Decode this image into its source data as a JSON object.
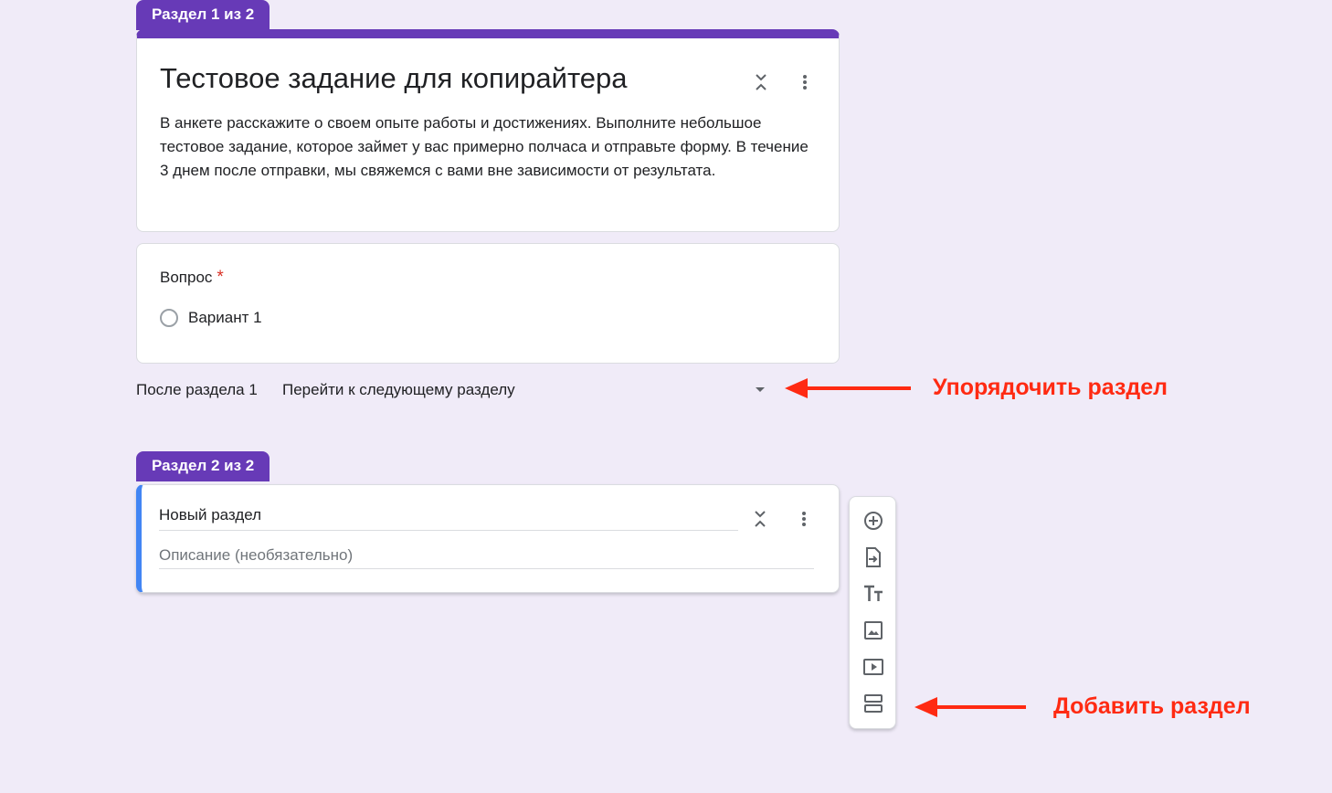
{
  "section1": {
    "tab_label": "Раздел 1 из 2",
    "title": "Тестовое задание для копирайтера",
    "description": "В анкете расскажите о своем опыте работы и достижениях. Выполните небольшое тестовое задание, которое займет у вас примерно полчаса и отправьте форму. В течение 3 днем после отправки, мы свяжемся с вами вне зависимости от результата."
  },
  "question": {
    "label": "Вопрос",
    "required_mark": "*",
    "option": "Вариант 1"
  },
  "after_section": {
    "label": "После раздела 1",
    "selected": "Перейти к следующему разделу"
  },
  "section2": {
    "tab_label": "Раздел 2 из 2",
    "title": "Новый раздел",
    "description_placeholder": "Описание (необязательно)"
  },
  "toolbar": {
    "icons": [
      "add-question-icon",
      "import-questions-icon",
      "add-title-icon",
      "add-image-icon",
      "add-video-icon",
      "add-section-icon"
    ]
  },
  "annotations": {
    "reorder": "Упорядочить раздел",
    "add_section": "Добавить раздел"
  },
  "colors": {
    "accent": "#673ab7",
    "background": "#f0ebf8",
    "active_section": "#4285f4",
    "required": "#d93025",
    "annotation": "#ff2a12"
  }
}
